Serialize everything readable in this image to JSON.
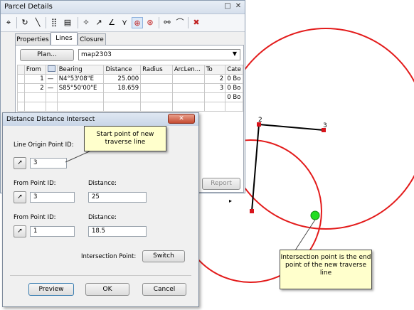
{
  "map": {
    "point_labels": [
      "2",
      "3"
    ]
  },
  "parcel_window": {
    "title": "Parcel Details",
    "title_buttons": {
      "pin": "□",
      "close": "✕"
    },
    "tabs": [
      "Properties",
      "Lines",
      "Closure"
    ],
    "active_tab": "Lines",
    "plan_button": "Plan...",
    "plan_value": "map2303",
    "columns": [
      "From",
      "",
      "Bearing",
      "Distance",
      "Radius",
      "ArcLen...",
      "To",
      "Cate"
    ],
    "rows": [
      {
        "from": "1",
        "bearing": "N4°53'08\"E",
        "distance": "25.000",
        "radius": "",
        "arclen": "",
        "to": "2",
        "category": "0 Bo"
      },
      {
        "from": "2",
        "bearing": "S85°50'00\"E",
        "distance": "18.659",
        "radius": "",
        "arclen": "",
        "to": "3",
        "category": "0 Bo"
      },
      {
        "from": "",
        "bearing": "",
        "distance": "",
        "radius": "",
        "arclen": "",
        "to": "",
        "category": "0 Bo"
      }
    ],
    "report_button": "Report",
    "scroll_arrow": "▸"
  },
  "dialog": {
    "title": "Distance Distance Intersect",
    "close_glyph": "✕",
    "origin_label": "Line Origin Point ID:",
    "origin_value": "3",
    "from1_label": "From Point ID:",
    "from1_value": "3",
    "dist1_label": "Distance:",
    "dist1_value": "25",
    "from2_label": "From Point ID:",
    "from2_value": "1",
    "dist2_label": "Distance:",
    "dist2_value": "18.5",
    "intersection_label": "Intersection Point:",
    "switch_button": "Switch",
    "preview_button": "Preview",
    "ok_button": "OK",
    "cancel_button": "Cancel"
  },
  "callouts": {
    "start": "Start point of new traverse line",
    "intersection": "Intersection point is the end point of the new traverse line"
  },
  "colors": {
    "circle": "#e31b1b",
    "intersection_point": "#22dd22",
    "callout_bg": "#ffffcc"
  }
}
